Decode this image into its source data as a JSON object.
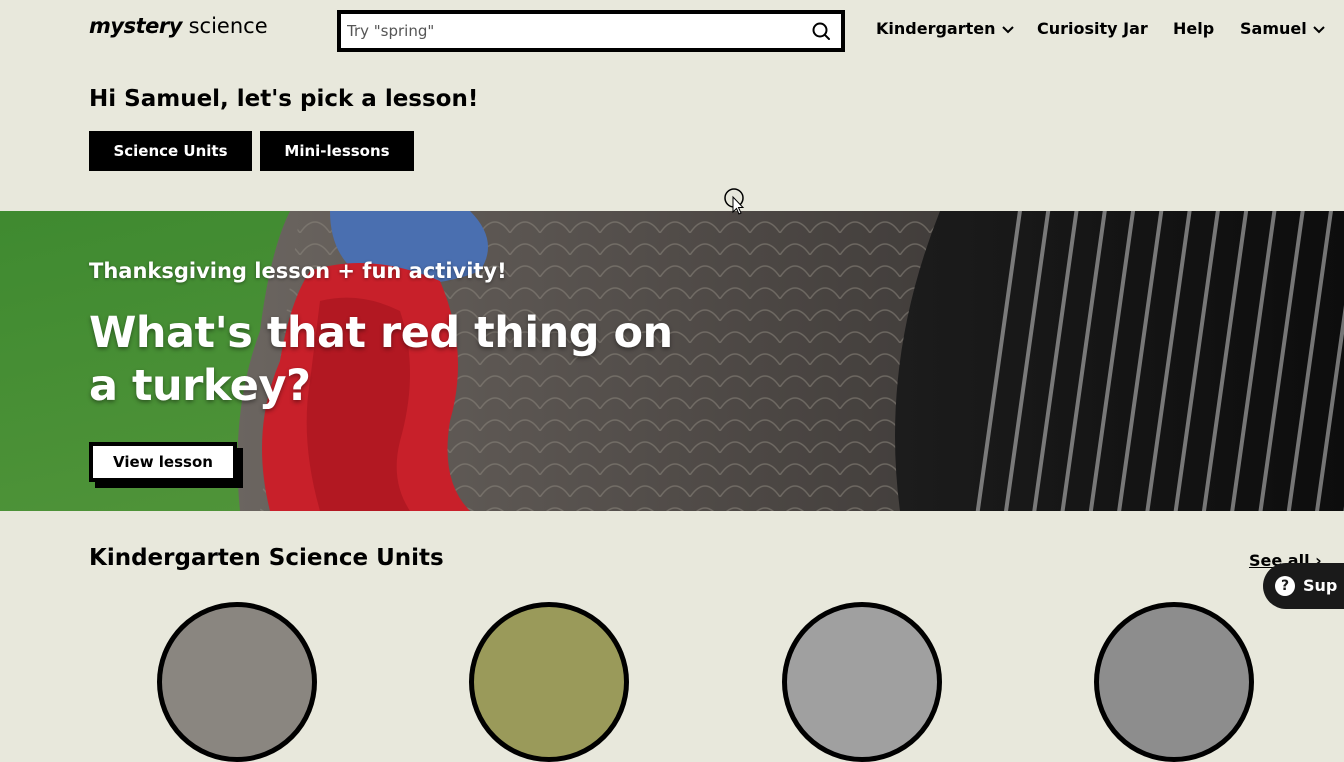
{
  "header": {
    "logo": {
      "bold": "mystery",
      "rest": "science"
    },
    "search": {
      "placeholder": "Try \"spring\"",
      "value": ""
    },
    "nav": [
      {
        "label": "Kindergarten",
        "has_dropdown": true
      },
      {
        "label": "Curiosity Jar",
        "has_dropdown": false
      },
      {
        "label": "Help",
        "has_dropdown": false
      },
      {
        "label": "Samuel",
        "has_dropdown": true
      }
    ]
  },
  "greeting": "Hi Samuel, let's pick a lesson!",
  "lesson_tabs": [
    {
      "label": "Science Units"
    },
    {
      "label": "Mini-lessons"
    }
  ],
  "hero": {
    "eyebrow": "Thanksgiving lesson + fun activity!",
    "title": "What's that red thing on a turkey?",
    "button": "View lesson"
  },
  "units": {
    "heading": "Kindergarten Science Units",
    "see_all": "See all"
  },
  "support": {
    "label": "Sup"
  },
  "colors": {
    "background": "#e8e8dc",
    "button": "#000000",
    "hero_green": "#4f8f3a",
    "turkey_red": "#c8202a"
  }
}
